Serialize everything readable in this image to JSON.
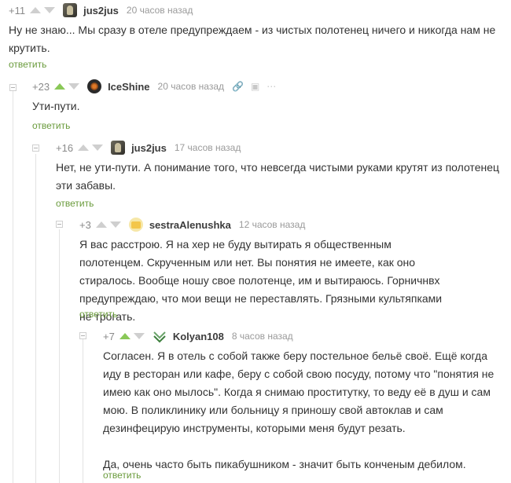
{
  "reply_label": "ответить",
  "comments": [
    {
      "rating": "+11",
      "user": "jus2jus",
      "time": "20 часов назад",
      "text": "Ну не знаю... Мы сразу в отеле предупреждаем - из чистых полотенец ничего и никогда нам не крутить."
    },
    {
      "rating": "+23",
      "user": "IceShine",
      "time": "20 часов назад",
      "text": "Ути-пути."
    },
    {
      "rating": "+16",
      "user": "jus2jus",
      "time": "17 часов назад",
      "text": "Нет, не ути-пути. А понимание того, что невсегда чистыми руками крутят из полотенец эти забавы."
    },
    {
      "rating": "+3",
      "user": "sestraAlenushka",
      "time": "12 часов назад",
      "text": "Я вас расстрою. Я на хер не буду вытирать я общественным полотенцем. Скрученным или нет. Вы понятия не имеете, как оно стиралось. Вообще ношу свое полотенце, им и вытираюсь. Горничнвх предупреждаю, что мои вещи не переставлять. Грязными культяпками не трогать."
    },
    {
      "rating": "+7",
      "user": "Kolyan108",
      "time": "8 часов назад",
      "text": "Согласен. Я в отель с собой также беру постельное бельё своё. Ещё когда иду в ресторан или кафе, беру с собой свою посуду, потому что \"понятия не имею как оно мылось\". Когда я снимаю проститутку, то веду её в душ и сам мою. В поликлинику или больницу я приношу свой автоклав и сам дезинфецирую инструменты, которыми меня будут резать.\n\nДа, очень часто быть пикабушником - значит быть конченым дебилом."
    }
  ]
}
